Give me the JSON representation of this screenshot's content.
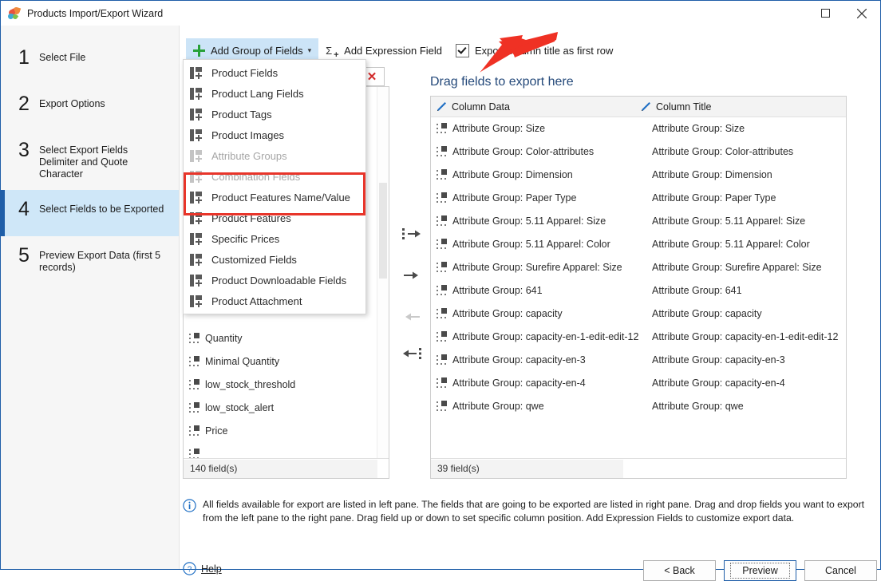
{
  "window": {
    "title": "Products Import/Export Wizard",
    "icon": "butterfly-app-icon",
    "maximize_label": "Maximize",
    "close_label": "Close"
  },
  "sidebar": {
    "steps": [
      {
        "num": "1",
        "label": "Select File",
        "active": false
      },
      {
        "num": "2",
        "label": "Export Options",
        "active": false
      },
      {
        "num": "3",
        "label": "Select Export Fields Delimiter and Quote Character",
        "active": false
      },
      {
        "num": "4",
        "label": "Select Fields to be Exported",
        "active": true
      },
      {
        "num": "5",
        "label": "Preview Export Data (first 5 records)",
        "active": false
      }
    ]
  },
  "toolbar": {
    "add_group_label": "Add Group of Fields",
    "add_group_caret": "▾",
    "add_expression_label": "Add Expression Field",
    "sigma_glyph": "Σ",
    "sigma_plus": "+",
    "export_title_checkbox_label": "Export column title as first row",
    "export_title_checked": true
  },
  "dropdown": {
    "items": [
      {
        "label": "Product Fields",
        "disabled": false
      },
      {
        "label": "Product Lang Fields",
        "disabled": false
      },
      {
        "label": "Product Tags",
        "disabled": false
      },
      {
        "label": "Product Images",
        "disabled": false
      },
      {
        "label": "Attribute Groups",
        "disabled": true
      },
      {
        "label": "Combination Fields",
        "disabled": true
      },
      {
        "label": "Product Features Name/Value",
        "disabled": false
      },
      {
        "label": "Product Features",
        "disabled": false
      },
      {
        "label": "Specific Prices",
        "disabled": false
      },
      {
        "label": "Customized Fields",
        "disabled": false
      },
      {
        "label": "Product Downloadable Fields",
        "disabled": false
      },
      {
        "label": "Product Attachment",
        "disabled": false
      }
    ],
    "highlight_color": "#e8352a"
  },
  "left_pane": {
    "clear_button": "✕",
    "rows": [
      "Quantity",
      "Minimal Quantity",
      "low_stock_threshold",
      "low_stock_alert",
      "Price"
    ],
    "footer": "140 field(s)"
  },
  "transfer": {
    "move_all_right": "move-all-right",
    "move_right": "move-right",
    "move_left": "move-left",
    "move_all_left": "move-all-left"
  },
  "right_pane": {
    "drag_hint": "Drag fields to export here",
    "columns": [
      "Column Data",
      "Column Title"
    ],
    "rows": [
      {
        "data": "Attribute Group: Size",
        "title": "Attribute Group: Size"
      },
      {
        "data": "Attribute Group: Color-attributes",
        "title": "Attribute Group: Color-attributes"
      },
      {
        "data": "Attribute Group: Dimension",
        "title": "Attribute Group: Dimension"
      },
      {
        "data": "Attribute Group: Paper Type",
        "title": "Attribute Group: Paper Type"
      },
      {
        "data": "Attribute Group: 5.11 Apparel: Size",
        "title": "Attribute Group: 5.11 Apparel: Size"
      },
      {
        "data": "Attribute Group: 5.11 Apparel: Color",
        "title": "Attribute Group: 5.11 Apparel: Color"
      },
      {
        "data": "Attribute Group: Surefire Apparel: Size",
        "title": "Attribute Group: Surefire Apparel: Size"
      },
      {
        "data": "Attribute Group: 641",
        "title": "Attribute Group: 641"
      },
      {
        "data": "Attribute Group: capacity",
        "title": "Attribute Group: capacity"
      },
      {
        "data": "Attribute Group: capacity-en-1-edit-edit-12",
        "title": "Attribute Group: capacity-en-1-edit-edit-12"
      },
      {
        "data": "Attribute Group: capacity-en-3",
        "title": "Attribute Group: capacity-en-3"
      },
      {
        "data": "Attribute Group: capacity-en-4",
        "title": "Attribute Group: capacity-en-4"
      },
      {
        "data": "Attribute Group: qwe",
        "title": "Attribute Group: qwe"
      }
    ],
    "footer": "39 field(s)"
  },
  "info": {
    "line1": "All fields available for export are listed in left pane. The fields that are going to be exported are listed in right pane. Drag and drop fields you want to export",
    "line2": "from the left pane to the right pane. Drag field up or down to set specific column position. Add Expression Fields to customize export data."
  },
  "footer": {
    "help_label": "Help",
    "back_label": "< Back",
    "preview_label": "Preview",
    "cancel_label": "Cancel"
  },
  "colors": {
    "accent": "#1f5ea8",
    "active_step_bg": "#cfe7f8",
    "annotation_red": "#e8352a",
    "plus_green": "#28a138"
  }
}
